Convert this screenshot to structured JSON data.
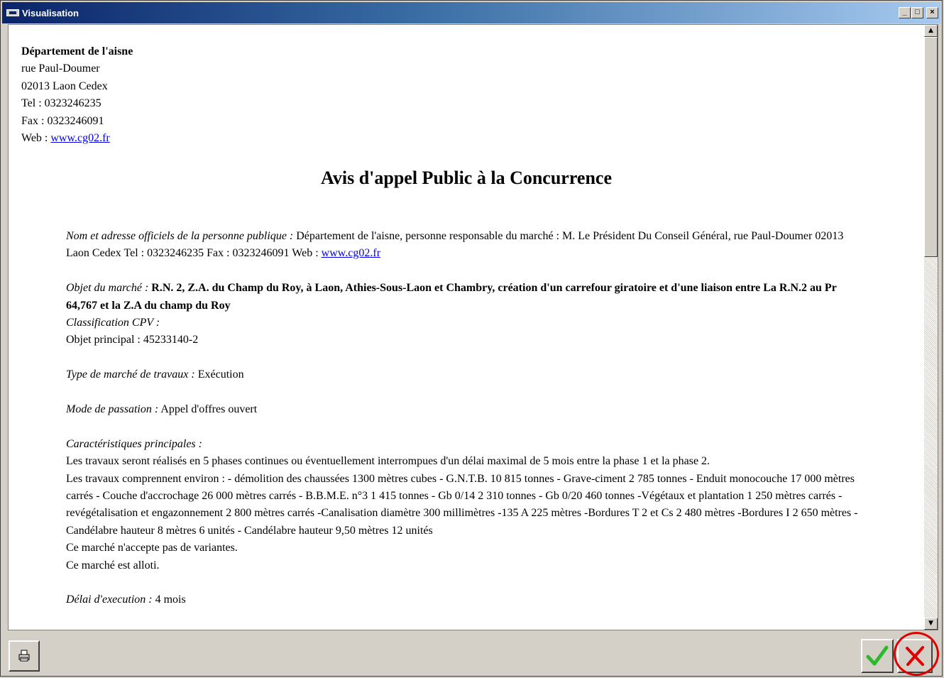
{
  "window": {
    "title": "Visualisation",
    "buttons": {
      "minimize": "_",
      "maximize": "□",
      "close": "×"
    }
  },
  "address": {
    "org": "Département de l'aisne",
    "street": "rue Paul-Doumer",
    "city": "02013 Laon Cedex",
    "tel": "Tel : 0323246235",
    "fax": "Fax : 0323246091",
    "web_label": "Web : ",
    "web_link": "www.cg02.fr"
  },
  "doc_title": "Avis d'appel Public à la Concurrence",
  "sections": {
    "nom": {
      "label": "Nom et adresse officiels de la personne publique :",
      "text": " Département de l'aisne, personne responsable du marché : M. Le Président Du Conseil Général, rue Paul-Doumer 02013 Laon Cedex Tel : 0323246235 Fax : 0323246091 Web : ",
      "link": "www.cg02.fr"
    },
    "objet": {
      "label": "Objet du marché :",
      "text": " R.N. 2, Z.A. du Champ du Roy, à Laon, Athies-Sous-Laon et Chambry, création d'un carrefour giratoire et d'une liaison entre La R.N.2 au Pr 64,767 et la Z.A du champ du Roy",
      "cpv_label": "Classification CPV :",
      "cpv_value": "Objet principal : 45233140-2"
    },
    "type": {
      "label": "Type de marché de travaux :",
      "value": " Exécution"
    },
    "mode": {
      "label": "Mode de passation :",
      "value": " Appel d'offres ouvert"
    },
    "caract": {
      "label": "Caractéristiques principales :",
      "line1": "Les travaux seront réalisés en 5 phases continues ou éventuellement interrompues d'un délai maximal de 5 mois entre la phase 1 et la phase 2.",
      "line2": "Les travaux comprennent environ : - démolition des chaussées 1300 mètres cubes - G.N.T.B. 10 815 tonnes - Grave-ciment 2 785 tonnes - Enduit monocouche 17 000 mètres carrés - Couche d'accrochage 26 000 mètres carrés - B.B.M.E. n°3 1 415 tonnes - Gb 0/14 2 310 tonnes - Gb 0/20 460 tonnes -Végétaux et plantation 1 250 mètres carrés -revégétalisation et engazonnement 2 800 mètres carrés -Canalisation diamètre 300 millimètres -135 A 225 mètres -Bordures T 2 et Cs 2 480 mètres -Bordures I 2 650 mètres -Candélabre hauteur 8 mètres 6 unités - Candélabre hauteur 9,50 mètres 12 unités",
      "line3": "Ce marché n'accepte pas de variantes.",
      "line4": "Ce marché est alloti."
    },
    "delai": {
      "label": "Délai d'execution :",
      "value": " 4 mois"
    }
  },
  "toolbar": {
    "print_icon": "printer-icon",
    "ok_icon": "checkmark-icon",
    "cancel_icon": "cancel-x-icon"
  },
  "colors": {
    "title_gradient_start": "#0a246a",
    "title_gradient_end": "#a6caf0",
    "ok_green": "#2db82d",
    "cancel_red": "#e00000",
    "highlight_ring": "#e00000"
  }
}
